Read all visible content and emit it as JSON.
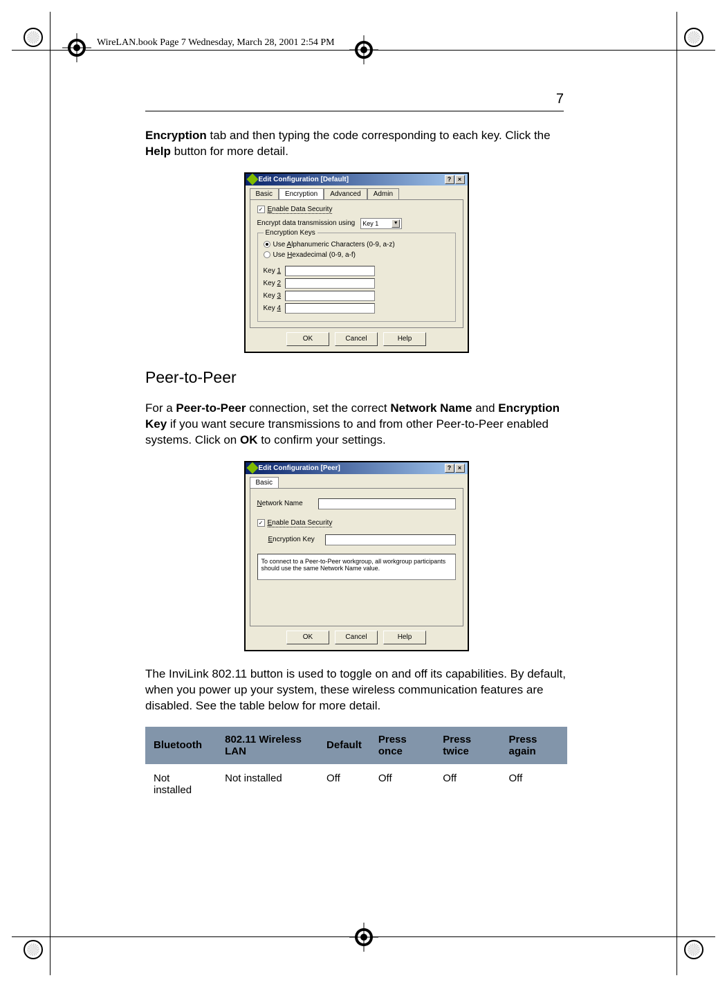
{
  "header": "WireLAN.book  Page 7  Wednesday, March 28, 2001  2:54 PM",
  "pageNumber": "7",
  "intro": {
    "b1": "Encryption",
    "t1": " tab and then typing the code corresponding to each key.  Click the ",
    "b2": "Help",
    "t2": " button for more detail."
  },
  "dialog1": {
    "title": "Edit Configuration [Default]",
    "helpGlyph": "?",
    "closeGlyph": "×",
    "tabs": {
      "basic": "Basic",
      "encryption": "Encryption",
      "advanced": "Advanced",
      "admin": "Admin"
    },
    "enableSec_pre": "E",
    "enableSec_rest": "nable Data Security",
    "enableSec_checked": "✓",
    "encryptUsingLabel": "Encrypt data transmission using",
    "selectVal": "Key 1",
    "group": "Encryption Keys",
    "radio1_pre": "Use ",
    "radio1_u": "A",
    "radio1_rest": "lphanumeric Characters (0-9, a-z)",
    "radio2_pre": "Use ",
    "radio2_u": "H",
    "radio2_rest": "exadecimal (0-9, a-f)",
    "key1_pre": "Key ",
    "key1_u": "1",
    "key2_pre": "Key ",
    "key2_u": "2",
    "key3_pre": "Key ",
    "key3_u": "3",
    "key4_pre": "Key ",
    "key4_u": "4",
    "ok": "OK",
    "cancel": "Cancel",
    "help": "Help"
  },
  "subhead": "Peer-to-Peer",
  "p2p": {
    "pre": "For a ",
    "b1": "Peer-to-Peer",
    "t1": " connection, set the correct ",
    "b2": "Network Name",
    "t2": " and ",
    "b3": "Encryption Key",
    "t3": " if you want secure transmissions to and from other Peer-to-Peer enabled systems.  Click on ",
    "b4": "OK",
    "t4": " to confirm your settings."
  },
  "dialog2": {
    "title": "Edit Configuration [Peer]",
    "helpGlyph": "?",
    "closeGlyph": "×",
    "tab": "Basic",
    "netName_u": "N",
    "netName_rest": "etwork Name",
    "enableSec_pre": "E",
    "enableSec_rest": "nable Data Security",
    "enableSec_checked": "✓",
    "encKey_u": "E",
    "encKey_rest": "ncryption Key",
    "info": "To connect to a Peer-to-Peer workgroup, all workgroup participants should use the same Network Name value.",
    "ok": "OK",
    "cancel": "Cancel",
    "help": "Help"
  },
  "afterP": "The InviLink 802.11 button is used to toggle on and off its capabilities.  By default, when you power up your system, these wireless communication features are disabled.  See the table below for more detail.",
  "table": {
    "headers": {
      "c1": "Bluetooth",
      "c2": "802.11 Wireless LAN",
      "c3": "Default",
      "c4": "Press once",
      "c5": "Press twice",
      "c6": "Press again"
    },
    "row": {
      "c1": "Not installed",
      "c2": "Not installed",
      "c3": "Off",
      "c4": "Off",
      "c5": "Off",
      "c6": "Off"
    }
  }
}
